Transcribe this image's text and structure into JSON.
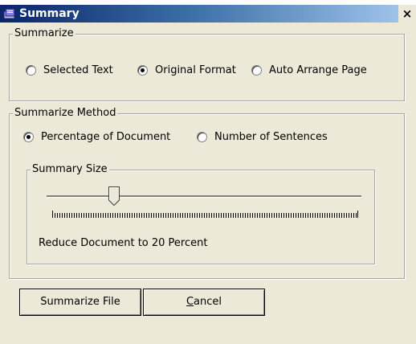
{
  "window": {
    "title": "Summary",
    "close_glyph": "×"
  },
  "summarize_group": {
    "legend": "Summarize",
    "options": [
      {
        "label": "Selected Text",
        "checked": false
      },
      {
        "label": "Original Format",
        "checked": true
      },
      {
        "label": "Auto Arrange Page",
        "checked": false
      }
    ]
  },
  "method_group": {
    "legend": "Summarize Method",
    "options": [
      {
        "label": "Percentage of Document",
        "checked": true
      },
      {
        "label": "Number of Sentences",
        "checked": false
      }
    ]
  },
  "size_group": {
    "legend": "Summary Size",
    "slider_percent": 20,
    "status_text": "Reduce Document to 20 Percent"
  },
  "buttons": {
    "summarize_file": "Summarize File",
    "cancel_first": "C",
    "cancel_rest": "ancel"
  },
  "icons": {
    "app": "summary-app-icon",
    "close": "close-icon"
  }
}
